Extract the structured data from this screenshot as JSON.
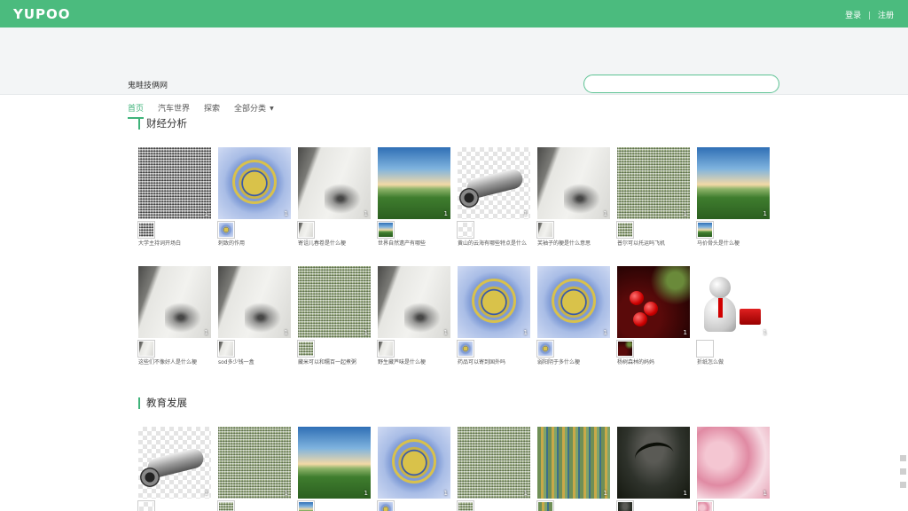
{
  "header": {
    "logo_text": "YUPOO",
    "login_label": "登录",
    "separator": "|",
    "register_label": "注册"
  },
  "site": {
    "title": "鬼畦技俩网"
  },
  "search": {
    "placeholder": ""
  },
  "nav": {
    "items": [
      {
        "label": "首页",
        "active": true
      },
      {
        "label": "汽车世界",
        "active": false
      },
      {
        "label": "探索",
        "active": false
      },
      {
        "label": "全部分类",
        "active": false,
        "dropdown": true
      }
    ],
    "dropdown_arrow": "▼"
  },
  "sections": [
    {
      "title": "财经分析",
      "cards": [
        {
          "caption": "大学主持词开场白",
          "count": "1",
          "image": "noise"
        },
        {
          "caption": "刺致的作用",
          "count": "1",
          "image": "seal"
        },
        {
          "caption": "寄诅儿春卷是什么梗",
          "count": "1",
          "image": "wall"
        },
        {
          "caption": "世界自然遗产有哪些",
          "count": "1",
          "image": "land"
        },
        {
          "caption": "黄山的云海有哪些特点是什么",
          "count": "1",
          "image": "tool"
        },
        {
          "caption": "芙袖子的梗是什么意思",
          "count": "1",
          "image": "wall"
        },
        {
          "caption": "普尔可以托运吗飞机",
          "count": "1",
          "image": "noise-green"
        },
        {
          "caption": "马价骨头是什么梗",
          "count": "1",
          "image": "land"
        },
        {
          "caption": "这些们不像好人是什么梗",
          "count": "1",
          "image": "wall"
        },
        {
          "caption": "sod多少钱一盒",
          "count": "1",
          "image": "wall"
        },
        {
          "caption": "藏米可以和糯百一起煮粥",
          "count": "1",
          "image": "noise-green"
        },
        {
          "caption": "野生藏芦味是什么梗",
          "count": "1",
          "image": "wall"
        },
        {
          "caption": "药品可以寄到国外吗",
          "count": "1",
          "image": "seal"
        },
        {
          "caption": "弱阳阴于多什么梗",
          "count": "1",
          "image": "seal"
        },
        {
          "caption": "杨树森林的妈妈",
          "count": "1",
          "image": "orn"
        },
        {
          "caption": "折纸怎么做",
          "count": "1",
          "image": "pawn"
        }
      ]
    },
    {
      "title": "教育发展",
      "cards": [
        {
          "caption": "",
          "count": "1",
          "image": "tool"
        },
        {
          "caption": "",
          "count": "1",
          "image": "noise-green"
        },
        {
          "caption": "",
          "count": "1",
          "image": "land"
        },
        {
          "caption": "",
          "count": "1",
          "image": "seal"
        },
        {
          "caption": "",
          "count": "1",
          "image": "noise-green"
        },
        {
          "caption": "",
          "count": "1",
          "image": "stripes"
        },
        {
          "caption": "",
          "count": "1",
          "image": "palm"
        },
        {
          "caption": "",
          "count": "1",
          "image": "pink"
        }
      ]
    }
  ]
}
